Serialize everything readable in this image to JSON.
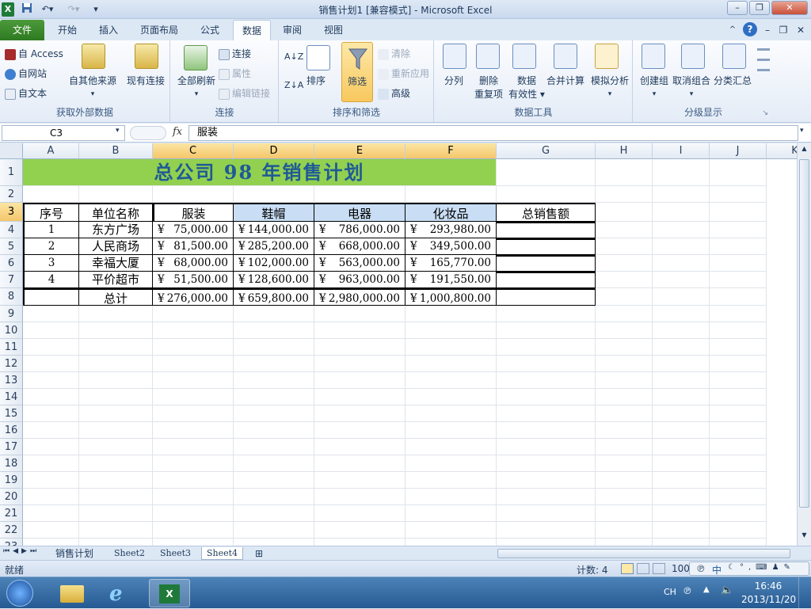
{
  "window": {
    "title": "销售计划1 [兼容模式] - Microsoft Excel",
    "app_icon": "excel-icon"
  },
  "quick_access": {
    "save": "save-icon",
    "undo": "undo-icon",
    "redo": "redo-icon",
    "customize": "▾"
  },
  "window_controls": {
    "minimize": "–",
    "restore": "❐",
    "close": "✕"
  },
  "tabs": [
    "文件",
    "开始",
    "插入",
    "页面布局",
    "公式",
    "数据",
    "审阅",
    "视图"
  ],
  "active_tab": "数据",
  "ribbon": {
    "groups": {
      "external": {
        "label": "获取外部数据",
        "access": "自 Access",
        "web": "自网站",
        "text": "自文本",
        "other": "自其他来源",
        "existing": "现有连接"
      },
      "connections": {
        "label": "连接",
        "refresh_all": "全部刷新",
        "connections": "连接",
        "properties": "属性",
        "edit_links": "编辑链接"
      },
      "sortfilter": {
        "label": "排序和筛选",
        "sort": "排序",
        "filter": "筛选",
        "clear": "清除",
        "reapply": "重新应用",
        "advanced": "高级"
      },
      "datatools": {
        "label": "数据工具",
        "split": "分列",
        "remove_dup_1": "删除",
        "remove_dup_2": "重复项",
        "validation_1": "数据",
        "validation_2": "有效性",
        "consolidate": "合并计算",
        "whatif": "模拟分析"
      },
      "outline": {
        "label": "分级显示",
        "group": "创建组",
        "ungroup": "取消组合",
        "subtotal": "分类汇总"
      }
    }
  },
  "formula_bar": {
    "name_box": "C3",
    "fx": "fx",
    "content": "服装"
  },
  "columns": [
    "A",
    "B",
    "C",
    "D",
    "E",
    "F",
    "G",
    "H",
    "I",
    "J",
    "K"
  ],
  "rows": [
    "1",
    "2",
    "3",
    "4",
    "5",
    "6",
    "7",
    "8",
    "9",
    "10",
    "11",
    "12",
    "13",
    "14",
    "15",
    "16",
    "17",
    "18",
    "19",
    "20",
    "21",
    "22",
    "23"
  ],
  "sheet": {
    "title": "总公司 98 年销售计划",
    "headers": [
      "序号",
      "单位名称",
      "服装",
      "鞋帽",
      "电器",
      "化妆品",
      "总销售额"
    ],
    "currency": "¥",
    "data": [
      {
        "no": "1",
        "name": "东方广场",
        "c": "75,000.00",
        "d": "144,000.00",
        "e": "786,000.00",
        "f": "293,980.00"
      },
      {
        "no": "2",
        "name": "人民商场",
        "c": "81,500.00",
        "d": "285,200.00",
        "e": "668,000.00",
        "f": "349,500.00"
      },
      {
        "no": "3",
        "name": "幸福大厦",
        "c": "68,000.00",
        "d": "102,000.00",
        "e": "563,000.00",
        "f": "165,770.00"
      },
      {
        "no": "4",
        "name": "平价超市",
        "c": "51,500.00",
        "d": "128,600.00",
        "e": "963,000.00",
        "f": "191,550.00"
      }
    ],
    "total": {
      "label": "总计",
      "c": "276,000.00",
      "d": "659,800.00",
      "e": "2,980,000.00",
      "f": "1,000,800.00"
    }
  },
  "sheet_tabs": [
    "销售计划",
    "Sheet2",
    "Sheet3",
    "Sheet4"
  ],
  "active_sheet": "Sheet4",
  "status": {
    "ready": "就绪",
    "count": "计数: 4",
    "zoom": "100"
  },
  "ime": {
    "label": "中"
  },
  "taskbar": {
    "lang": "CH",
    "time": "16:46",
    "date": "2013/11/20"
  },
  "colors": {
    "title_fill": "#92d050",
    "title_text": "#1f5a96",
    "header_fill": "#c9def5",
    "selection": "#f5c66a",
    "file_tab": "#2e7a22"
  }
}
